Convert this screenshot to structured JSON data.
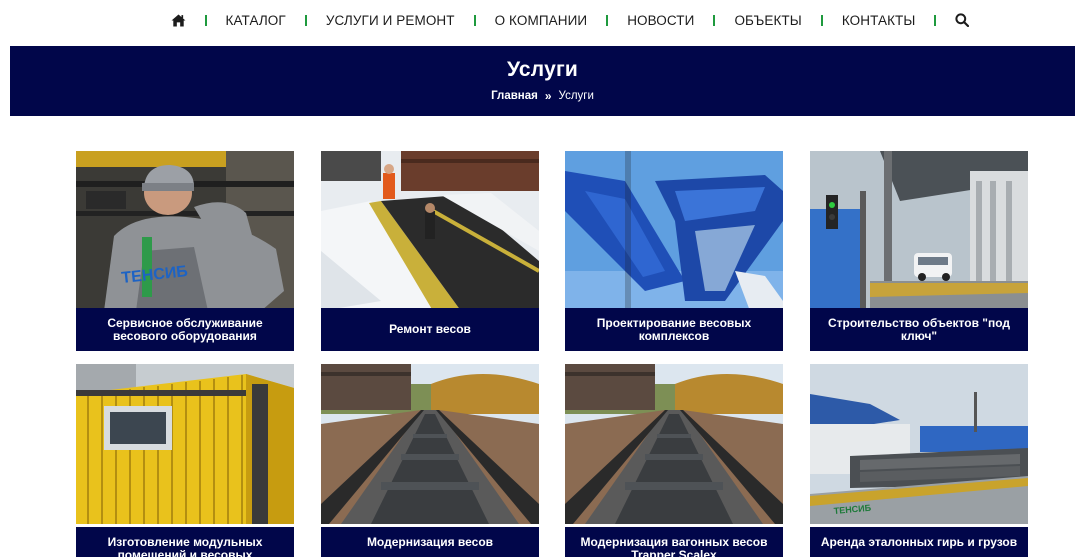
{
  "nav": {
    "items": [
      {
        "label": "КАТАЛОГ"
      },
      {
        "label": "УСЛУГИ И РЕМОНТ"
      },
      {
        "label": "О КОМПАНИИ"
      },
      {
        "label": "НОВОСТИ"
      },
      {
        "label": "ОБЪЕКТЫ"
      },
      {
        "label": "КОНТАКТЫ"
      }
    ],
    "icons": {
      "home": "home-icon",
      "search": "search-icon"
    }
  },
  "banner": {
    "title": "Услуги",
    "breadcrumb": {
      "home": "Главная",
      "separator": "»",
      "current": "Услуги"
    }
  },
  "cards": [
    {
      "caption": "Сервисное обслуживание весового оборудования",
      "photo_text": "ТЕНСИБ"
    },
    {
      "caption": "Ремонт весов"
    },
    {
      "caption": "Проектирование весовых комплексов"
    },
    {
      "caption": "Строительство объектов \"под ключ\""
    },
    {
      "caption": "Изготовление модульных помещений и весовых"
    },
    {
      "caption": "Модернизация весов"
    },
    {
      "caption": "Модернизация вагонных весов Trapper Scalex"
    },
    {
      "caption": "Аренда эталонных гирь и грузов",
      "photo_text": "ТЕНСИБ"
    }
  ],
  "colors": {
    "banner_bg": "#01064a",
    "separator": "#1f9a3e",
    "text": "#1c1c1c"
  }
}
